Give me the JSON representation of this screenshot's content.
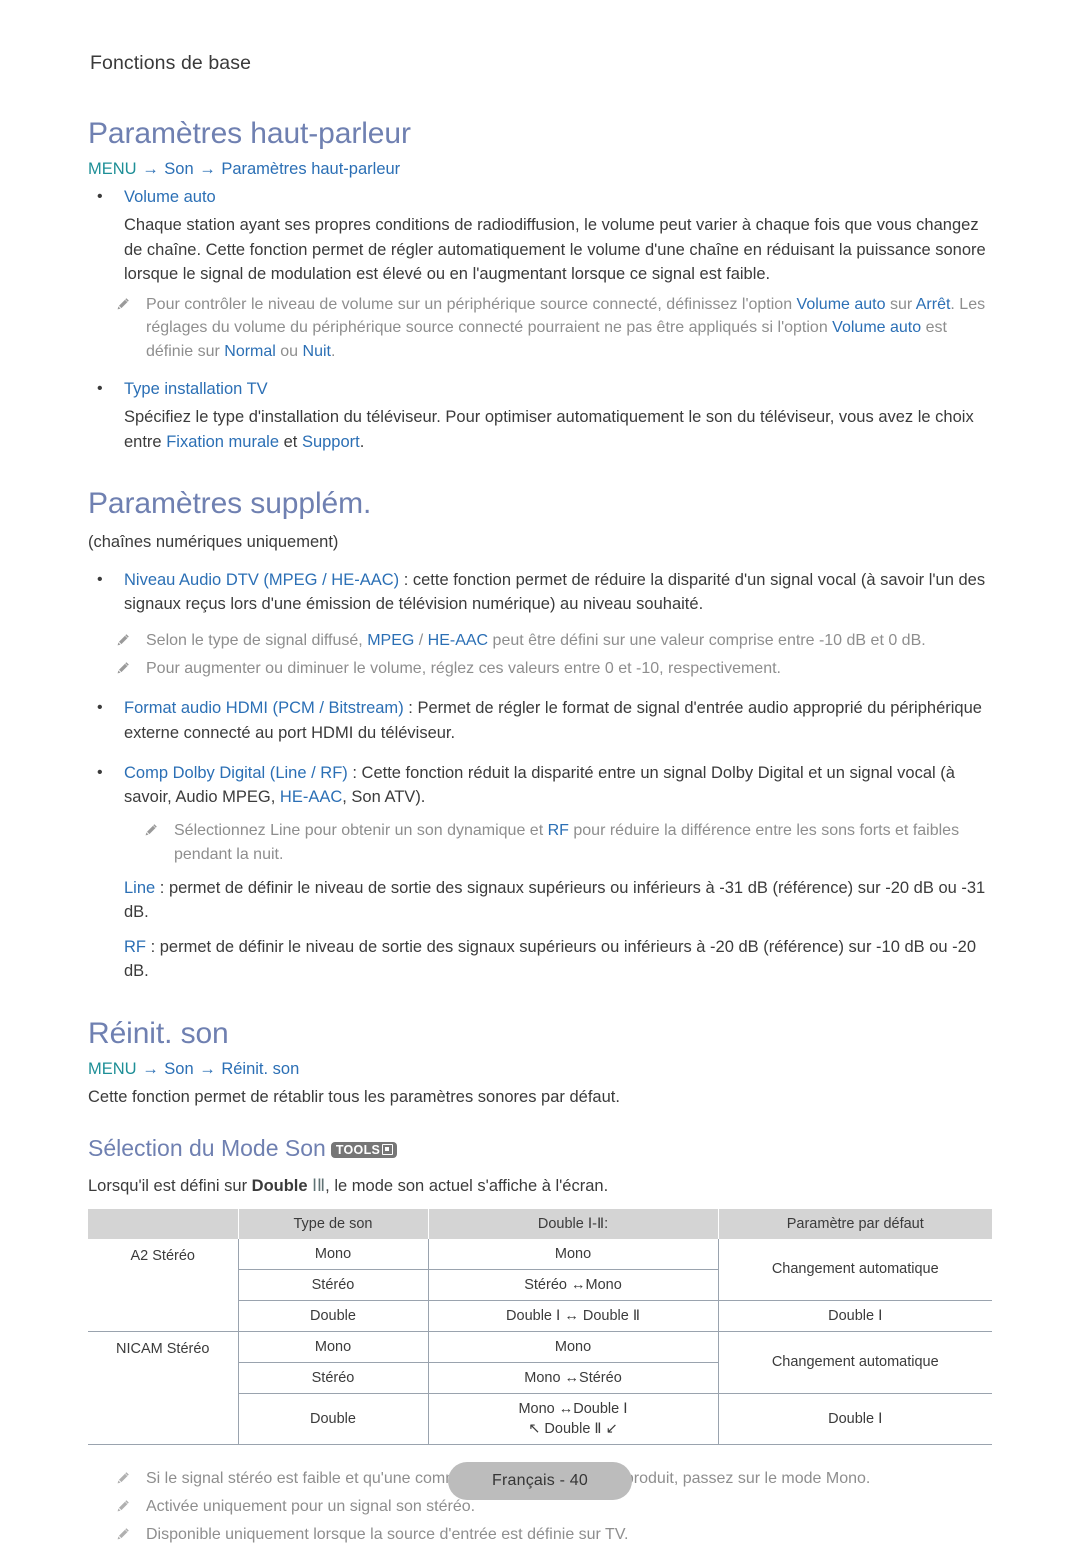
{
  "running_head": "Fonctions de base",
  "colors": {
    "heading": "#6F80B1",
    "link": "#2B6FB5",
    "menu_word": "#1E8F97",
    "note_text": "#8E8E8E",
    "table_header_bg": "#D4D4D4",
    "footer_pill_bg": "#BCBCBC"
  },
  "section1": {
    "title": "Paramètres haut-parleur",
    "menu_path": {
      "menu": "MENU",
      "arrow": "→",
      "step1": "Son",
      "step2": "Paramètres haut-parleur"
    },
    "item1": {
      "label": "Volume auto",
      "body": "Chaque station ayant ses propres conditions de radiodiffusion, le volume peut varier à chaque fois que vous changez de chaîne. Cette fonction permet de régler automatiquement le volume d'une chaîne en réduisant la puissance sonore lorsque le signal de modulation est élevé ou en l'augmentant lorsque ce signal est faible.",
      "note_a": {
        "t1": "Pour contrôler le niveau de volume sur un périphérique source connecté, définissez l'option ",
        "h1": "Volume auto",
        "t2": " sur ",
        "h2": "Arrêt",
        "t3": ". Les réglages du volume du périphérique source connecté pourraient ne pas être appliqués si l'option ",
        "h3": "Volume auto",
        "t4": " est définie sur ",
        "h4": "Normal",
        "t5": " ou ",
        "h5": "Nuit",
        "t6": "."
      }
    },
    "item2": {
      "label": "Type installation TV",
      "body_pre": "Spécifiez le type d'installation du téléviseur. Pour optimiser automatiquement le son du téléviseur, vous avez le choix entre ",
      "link1": "Fixation murale",
      "body_mid": " et ",
      "link2": "Support",
      "body_post": "."
    }
  },
  "section2": {
    "title": "Paramètres supplém.",
    "subtitle": "(chaînes numériques uniquement)",
    "item1": {
      "label": "Niveau Audio DTV",
      "paren_open": " (",
      "opt1": "MPEG",
      "sep": " / ",
      "opt2": "HE-AAC",
      "paren_close": ")",
      "body": " : cette fonction permet de réduire la disparité d'un signal vocal (à savoir l'un des signaux reçus lors d'une émission de télévision numérique) au niveau souhaité.",
      "note_a": {
        "t1": "Selon le type de signal diffusé, ",
        "h1": "MPEG",
        "t2": " / ",
        "h2": "HE-AAC",
        "t3": " peut être défini sur une valeur comprise entre -10 dB et 0 dB."
      },
      "note_b": "Pour augmenter ou diminuer le volume, réglez ces valeurs entre 0 et -10, respectivement."
    },
    "item2": {
      "label": "Format audio HDMI",
      "paren_open": " (",
      "opt1": "PCM",
      "sep": " / ",
      "opt2": "Bitstream",
      "paren_close": ")",
      "body": " : Permet de régler le format de signal d'entrée audio approprié du périphérique externe connecté au port HDMI du téléviseur."
    },
    "item3": {
      "label": "Comp Dolby Digital",
      "paren_open": " (",
      "opt1": "Line",
      "sep": " / ",
      "opt2": "RF",
      "paren_close": ")",
      "body_pre": " : Cette fonction réduit la disparité entre un signal Dolby Digital et un signal vocal (à savoir, Audio MPEG, ",
      "inline_link": "HE-AAC",
      "body_post": ", Son ATV).",
      "note_a": {
        "t1": "Sélectionnez Line pour obtenir un son dynamique et ",
        "h1": "RF",
        "t2": " pour réduire la différence entre les sons forts et faibles pendant la nuit."
      },
      "line_def": {
        "term": "Line",
        "text": " : permet de définir le niveau de sortie des signaux supérieurs ou inférieurs à -31 dB (référence) sur -20 dB ou -31 dB."
      },
      "rf_def": {
        "term": "RF",
        "text": " : permet de définir le niveau de sortie des signaux supérieurs ou inférieurs à -20 dB (référence) sur -10 dB ou -20 dB."
      }
    }
  },
  "section3": {
    "title": "Réinit. son",
    "menu_path": {
      "menu": "MENU",
      "arrow": "→",
      "step1": "Son",
      "step2": "Réinit. son"
    },
    "body": "Cette fonction permet de rétablir tous les paramètres sonores par défaut."
  },
  "section4": {
    "title": "Sélection du Mode Son",
    "tools_badge": "TOOLS",
    "intro_pre": "Lorsqu'il est défini sur ",
    "intro_bold": "Double",
    "intro_rn": "ⅠⅡ",
    "intro_post": ", le mode son actuel s'affiche à l'écran.",
    "table": {
      "headers": [
        "",
        "Type de son",
        "Double Ⅰ-Ⅱ:",
        "Paramètre par défaut"
      ],
      "groups": [
        {
          "name": "A2 Stéréo",
          "rows": [
            {
              "type": "Mono",
              "double": "Mono",
              "default": "Changement automatique",
              "default_span": 2
            },
            {
              "type": "Stéréo",
              "double": "Stéréo ↔Mono"
            },
            {
              "type": "Double",
              "double": "Double Ⅰ ↔ Double Ⅱ",
              "default": "Double Ⅰ",
              "default_span": 1
            }
          ]
        },
        {
          "name": "NICAM Stéréo",
          "rows": [
            {
              "type": "Mono",
              "double": "Mono",
              "default": "Changement automatique",
              "default_span": 2
            },
            {
              "type": "Stéréo",
              "double": "Mono ↔Stéréo"
            },
            {
              "type": "Double",
              "double": "Mono ↔Double Ⅰ",
              "double_line2": "↖ Double Ⅱ ↙",
              "default": "Double Ⅰ",
              "default_span": 1
            }
          ]
        }
      ]
    },
    "notes": [
      "Si le signal stéréo est faible et qu'une commutation automatique se produit, passez sur le mode Mono.",
      "Activée uniquement pour un signal son stéréo.",
      "Disponible uniquement lorsque la source d'entrée est définie sur TV."
    ]
  },
  "footer": {
    "label": "Français - 40"
  }
}
